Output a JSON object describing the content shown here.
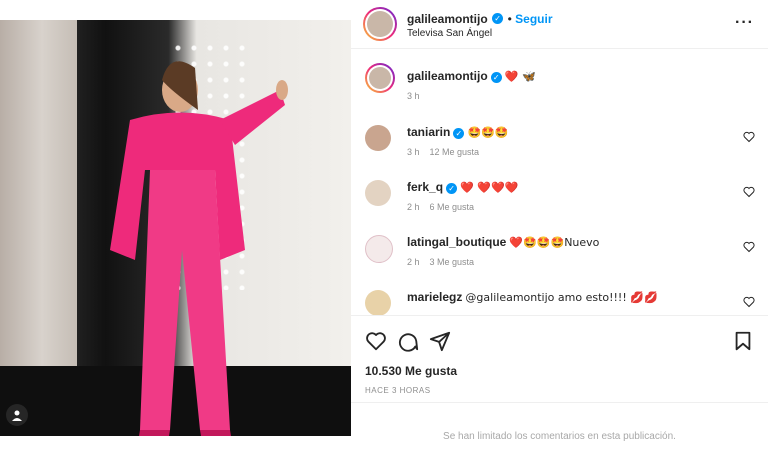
{
  "post": {
    "username": "galileamontijo",
    "follow_label": "Seguir",
    "location": "Televisa San Ángel",
    "verified_badge": "✓"
  },
  "caption": {
    "username": "galileamontijo",
    "emojis": "❤️ 🦋",
    "time": "3 h"
  },
  "comments": [
    {
      "username": "taniarin",
      "verified": true,
      "text": "🤩🤩🤩",
      "time": "3 h",
      "likes": "12 Me gusta"
    },
    {
      "username": "ferk_q",
      "verified": true,
      "text": "❤️ ❤️❤️❤️",
      "time": "2 h",
      "likes": "6 Me gusta"
    },
    {
      "username": "latingal_boutique",
      "verified": false,
      "text": "❤️🤩🤩🤩Nuevo",
      "time": "2 h",
      "likes": "3 Me gusta"
    },
    {
      "username": "marielegz",
      "verified": false,
      "text": "@galileamontijo amo esto!!!! 💋💋",
      "time": "",
      "likes": ""
    }
  ],
  "actions": {
    "like_icon": "heart-icon",
    "comment_icon": "comment-icon",
    "share_icon": "send-icon",
    "save_icon": "bookmark-icon"
  },
  "likes_count": "10.530 Me gusta",
  "posted_time": "HACE 3 HORAS",
  "comments_limited": "Se han limitado los comentarios en esta publicación.",
  "colors": {
    "accent": "#0095f6",
    "outfit": "#ee2a7b",
    "text": "#262626",
    "muted": "#8e8e8e"
  }
}
